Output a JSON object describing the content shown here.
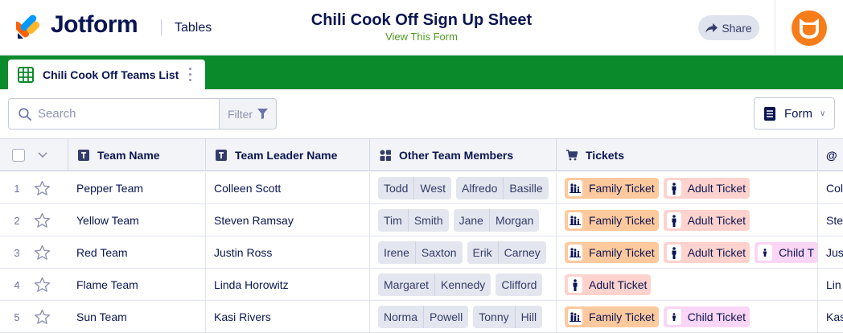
{
  "header": {
    "brand": "Jotform",
    "section": "Tables",
    "form_title": "Chili Cook Off Sign Up Sheet",
    "view_form": "View This Form",
    "share_label": "Share"
  },
  "colors": {
    "green": "#0b8a2c",
    "accent_orange": "#f77d1a",
    "navy": "#0a1551"
  },
  "tab": {
    "label": "Chili Cook Off Teams List"
  },
  "toolbar": {
    "search_placeholder": "Search",
    "filter_label": "Filter",
    "form_label": "Form"
  },
  "columns": {
    "team_name": "Team Name",
    "team_leader": "Team Leader Name",
    "members": "Other Team Members",
    "tickets": "Tickets",
    "last": "@"
  },
  "rows": [
    {
      "num": "1",
      "team": "Pepper Team",
      "leader": "Colleen Scott",
      "members": [
        [
          "Todd",
          "West"
        ],
        [
          "Alfredo",
          "Basille"
        ]
      ],
      "tickets": [
        {
          "type": "family",
          "label": "Family Ticket"
        },
        {
          "type": "adult",
          "label": "Adult Ticket"
        }
      ],
      "last": "Col"
    },
    {
      "num": "2",
      "team": "Yellow Team",
      "leader": "Steven Ramsay",
      "members": [
        [
          "Tim",
          "Smith"
        ],
        [
          "Jane",
          "Morgan"
        ]
      ],
      "tickets": [
        {
          "type": "family",
          "label": "Family Ticket"
        },
        {
          "type": "adult",
          "label": "Adult Ticket"
        }
      ],
      "last": "Ste"
    },
    {
      "num": "3",
      "team": "Red Team",
      "leader": "Justin Ross",
      "members": [
        [
          "Irene",
          "Saxton"
        ],
        [
          "Erik",
          "Carney"
        ]
      ],
      "tickets": [
        {
          "type": "family",
          "label": "Family Ticket"
        },
        {
          "type": "adult",
          "label": "Adult Ticket"
        },
        {
          "type": "child",
          "label": "Child T"
        }
      ],
      "last": "Jus"
    },
    {
      "num": "4",
      "team": "Flame Team",
      "leader": "Linda Horowitz",
      "members": [
        [
          "Margaret",
          "Kennedy"
        ],
        [
          "Clifford"
        ]
      ],
      "tickets": [
        {
          "type": "adult",
          "label": "Adult Ticket"
        }
      ],
      "last": "Lin"
    },
    {
      "num": "5",
      "team": "Sun Team",
      "leader": "Kasi Rivers",
      "members": [
        [
          "Norma",
          "Powell"
        ],
        [
          "Tonny",
          "Hill"
        ]
      ],
      "tickets": [
        {
          "type": "family",
          "label": "Family Ticket"
        },
        {
          "type": "child",
          "label": "Child Ticket"
        }
      ],
      "last": "Kas"
    }
  ]
}
